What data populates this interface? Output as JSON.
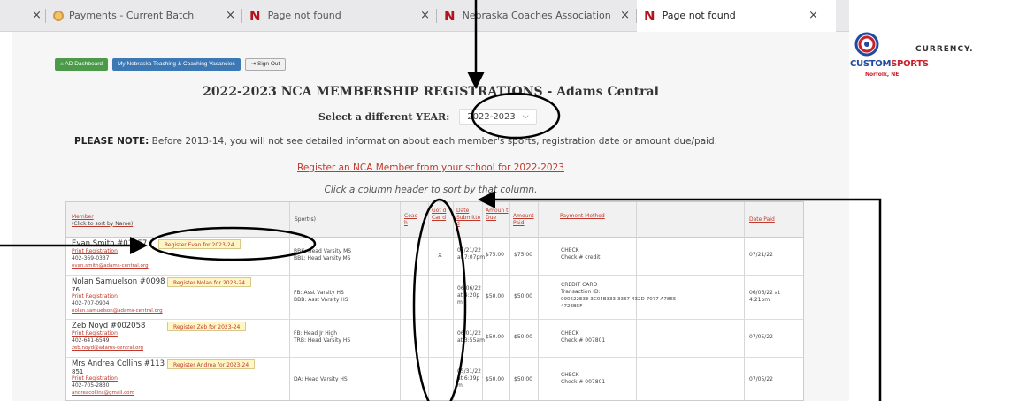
{
  "browser": {
    "tabs": [
      {
        "label": "",
        "close": "×"
      },
      {
        "label": "Payments - Current Batch",
        "close": "×"
      },
      {
        "label": "Page not found",
        "close": "×"
      },
      {
        "label": "Nebraska Coaches Association",
        "close": "×"
      },
      {
        "label": "Page not found",
        "close": "×"
      }
    ]
  },
  "toolbar": {
    "dashboard": "AD Dashboard",
    "vacancies": "My Nebraska Teaching & Coaching Vacancies",
    "signout": "Sign Out"
  },
  "page": {
    "title": "2022-2023 NCA MEMBERSHIP REGISTRATIONS - Adams Central",
    "year_label": "Select a different YEAR:",
    "year_value": "2022-2023",
    "note_bold": "PLEASE NOTE:",
    "note_text": " Before 2013-14, you will not see detailed information about each member's sports, registration date or amount due/paid.",
    "register_link": "Register an NCA Member from your school for 2022-2023",
    "click_info": "Click a column header to sort by that column."
  },
  "table": {
    "headers": {
      "member": "Member",
      "member_sub": "(Click to sort by Name)",
      "sports": "Sport(s)",
      "col3": "Coac h",
      "col4": "Got d Car d",
      "submitted": "Date Submitte d",
      "due": "Amoun t Due",
      "paid": "Amount Paid",
      "method": "Payment Method",
      "datepaid": "Date Paid"
    },
    "rows": [
      {
        "name": "Evan Smith #01657",
        "print": "Print Registration",
        "phone": "402-369-0337",
        "email": "evan.smith@adams-central.org",
        "register": "Register Evan for 2023-24",
        "sports": [
          "BBK: Head Varsity MS",
          "BBL: Head Varsity MS"
        ],
        "card": "X",
        "submitted": [
          "07/21/22",
          "at 7:07pm"
        ],
        "due": "$75.00",
        "paid": "$75.00",
        "method": [
          "CHECK",
          "Check # credit"
        ],
        "datepaid": "07/21/22"
      },
      {
        "name": "Nolan Samuelson #0098",
        "name2": "76",
        "print": "Print Registration",
        "phone": "402-707-0904",
        "email": "nolan.samuelson@adams-central.org",
        "register": "Register Nolan for 2023-24",
        "sports": [
          "FB: Asst Varsity HS",
          "BBB: Asst Varsity HS"
        ],
        "card": "",
        "submitted": [
          "06/06/22",
          "at 4:20p",
          "m"
        ],
        "due": "$50.00",
        "paid": "$50.00",
        "method": [
          "CREDIT CARD",
          "Transaction ID:",
          "090622E3E-3C04B333-33E7-432D-7077-A7865",
          "4723B5F"
        ],
        "datepaid": "06/06/22 at 4:21pm"
      },
      {
        "name": "Zeb Noyd #002058",
        "print": "Print Registration",
        "phone": "402-641-6549",
        "email": "zeb.noyd@adams-central.org",
        "register": "Register Zeb for 2023-24",
        "sports": [
          "FB: Head Jr High",
          "TRB: Head Varsity HS"
        ],
        "card": "",
        "submitted": [
          "06/01/22",
          "at 3:55am"
        ],
        "due": "$50.00",
        "paid": "$50.00",
        "method": [
          "CHECK",
          "Check # 007801"
        ],
        "datepaid": "07/05/22"
      },
      {
        "name": "Mrs Andrea Collins #113",
        "name2": "851",
        "print": "Print Registration",
        "phone": "402-705-2830",
        "email": "andreacollins@gmail.com",
        "register": "Register Andrea for 2023-24",
        "sports": [
          "DA: Head Varsity HS"
        ],
        "card": "",
        "submitted": [
          "05/31/22",
          "at 6:39p",
          "m"
        ],
        "due": "$50.00",
        "paid": "$50.00",
        "method": [
          "CHECK",
          "Check # 007801"
        ],
        "datepaid": "07/05/22"
      }
    ]
  },
  "logos": {
    "custom_sports": "CUSTOMSPORTS",
    "custom_sports_a": "CUSTOM",
    "custom_sports_b": "SPORTS",
    "norfolk": "Norfolk, NE",
    "currency": "CURRENCY."
  }
}
